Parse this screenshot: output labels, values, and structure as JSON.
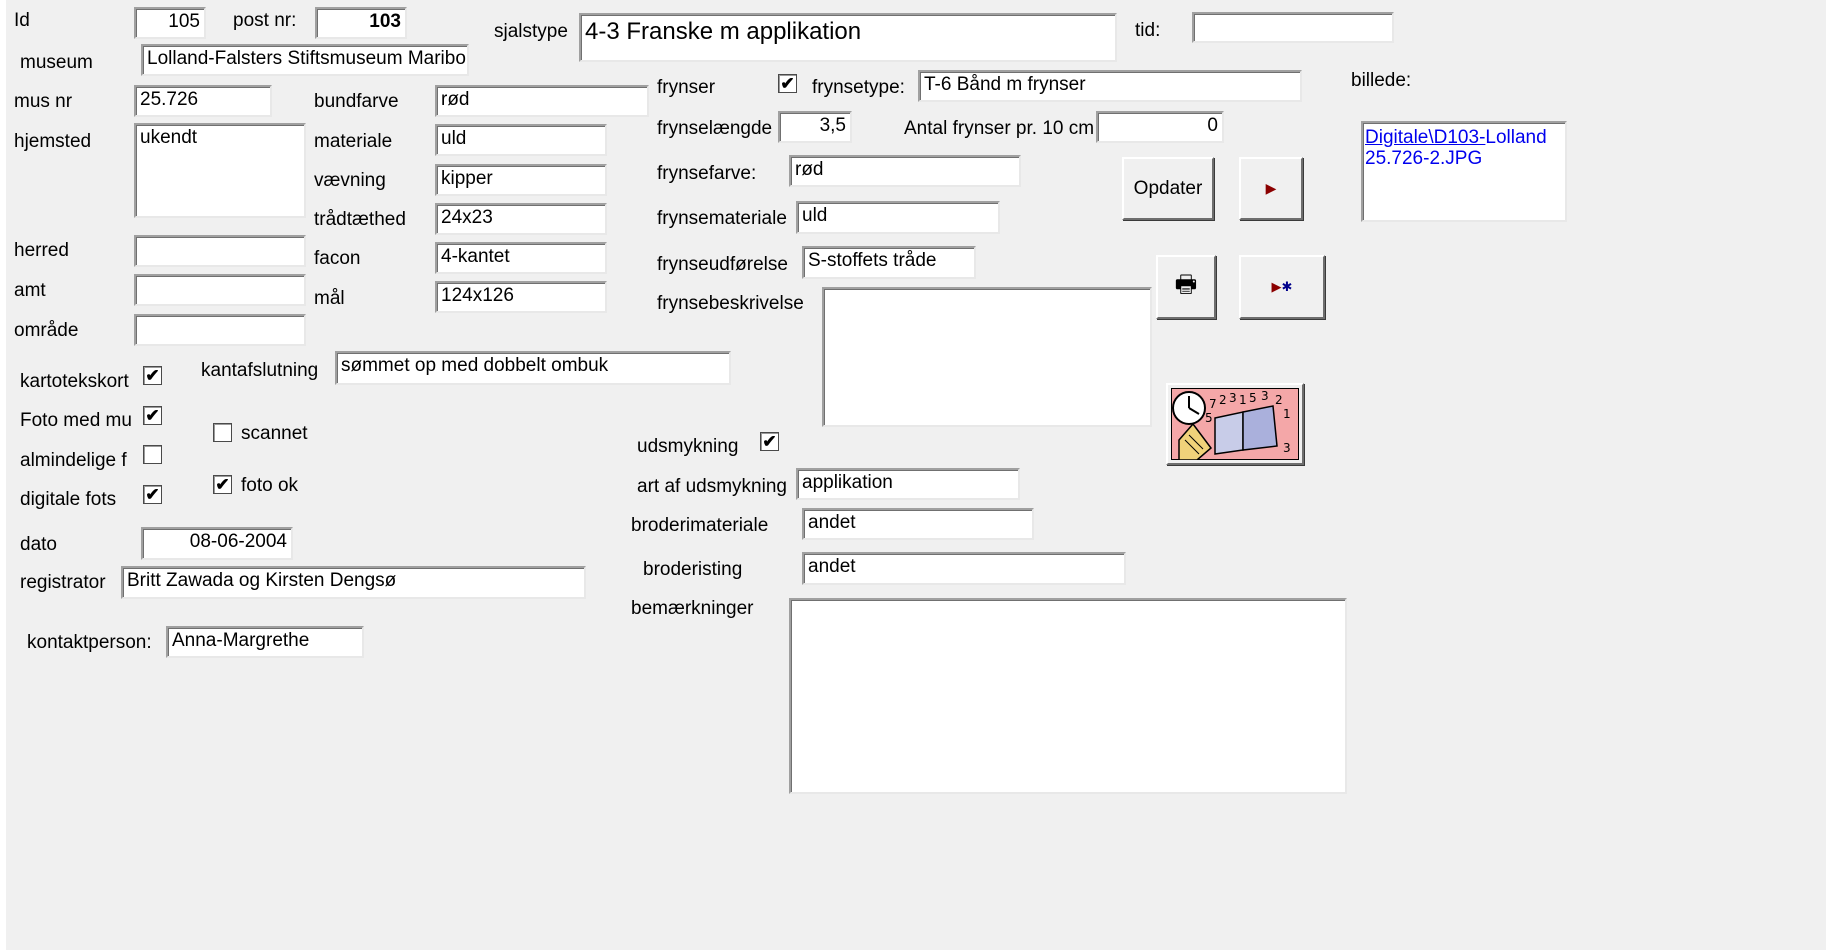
{
  "fields": {
    "id": {
      "label": "Id",
      "value": "105"
    },
    "post_nr": {
      "label": "post nr:",
      "value": "103"
    },
    "sjalstype": {
      "label": "sjalstype",
      "value": "4-3 Franske m applikation"
    },
    "tid": {
      "label": "tid:",
      "value": ""
    },
    "museum": {
      "label": "museum",
      "value": "Lolland-Falsters Stiftsmuseum Maribo"
    },
    "mus_nr": {
      "label": "mus nr",
      "value": "25.726"
    },
    "hjemsted": {
      "label": "hjemsted",
      "value": "ukendt"
    },
    "herred": {
      "label": "herred",
      "value": ""
    },
    "amt": {
      "label": "amt",
      "value": ""
    },
    "omraade": {
      "label": "område",
      "value": ""
    },
    "bundfarve": {
      "label": "bundfarve",
      "value": "rød"
    },
    "materiale": {
      "label": "materiale",
      "value": "uld"
    },
    "vaevning": {
      "label": "vævning",
      "value": "kipper"
    },
    "traadtaethed": {
      "label": "trådtæthed",
      "value": "24x23"
    },
    "facon": {
      "label": "facon",
      "value": "4-kantet"
    },
    "maal": {
      "label": "mål",
      "value": "124x126"
    },
    "kantafslutning": {
      "label": "kantafslutning",
      "value": "sømmet op med dobbelt ombuk"
    },
    "frynsetype": {
      "label": "frynsetype:",
      "value": "T-6 Bånd m frynser"
    },
    "frynselaengde": {
      "label": "frynselængde",
      "value": "3,5"
    },
    "antal_frynser": {
      "label": "Antal frynser pr. 10 cm",
      "value": "0"
    },
    "frynsefarve": {
      "label": "frynsefarve:",
      "value": "rød"
    },
    "frynsemateriale": {
      "label": "frynsemateriale",
      "value": "uld"
    },
    "frynseudfoerelse": {
      "label": "frynseudførelse",
      "value": "S-stoffets tråde"
    },
    "frynsebeskrivelse": {
      "label": "frynsebeskrivelse",
      "value": ""
    },
    "art_af_udsmykning": {
      "label": "art af udsmykning",
      "value": "applikation"
    },
    "broderimateriale": {
      "label": "broderimateriale",
      "value": "andet"
    },
    "broderisting": {
      "label": "broderisting",
      "value": "andet"
    },
    "bemaerkninger": {
      "label": "bemærkninger",
      "value": ""
    },
    "dato": {
      "label": "dato",
      "value": "08-06-2004"
    },
    "registrator": {
      "label": "registrator",
      "value": "Britt Zawada og Kirsten Dengsø"
    },
    "kontaktperson": {
      "label": "kontaktperson:",
      "value": "Anna-Margrethe"
    }
  },
  "checkboxes": {
    "frynser": {
      "label": "frynser",
      "checked": true
    },
    "kartotekskort": {
      "label": "kartotekskort",
      "checked": true
    },
    "foto_med_mu": {
      "label": "Foto med mu",
      "checked": true
    },
    "almindelige_f": {
      "label": "almindelige f",
      "checked": false
    },
    "digitale_fots": {
      "label": "digitale fots",
      "checked": true
    },
    "scannet": {
      "label": "scannet",
      "checked": false
    },
    "foto_ok": {
      "label": "foto ok",
      "checked": true
    },
    "udsmykning": {
      "label": "udsmykning",
      "checked": true
    }
  },
  "check_mark": "✔",
  "billede": {
    "label": "billede:",
    "link_text": "Digitale\\D103-",
    "text_rest": "Lolland",
    "line2": "25.726-2.JPG"
  },
  "buttons": {
    "opdater": "Opdater",
    "next_icon": "next-record-icon",
    "print_icon": "printer-icon",
    "new_icon": "new-record-icon",
    "calendar_icon": "calendar-book-icon"
  },
  "icon_glyphs": {
    "next": "▶",
    "new_star": "✱",
    "printer": "🖶"
  },
  "colors": {
    "record_nav": "#8b0000",
    "new_star": "#00008b",
    "link": "#0000ee",
    "form_bg": "#f0f0f0"
  }
}
